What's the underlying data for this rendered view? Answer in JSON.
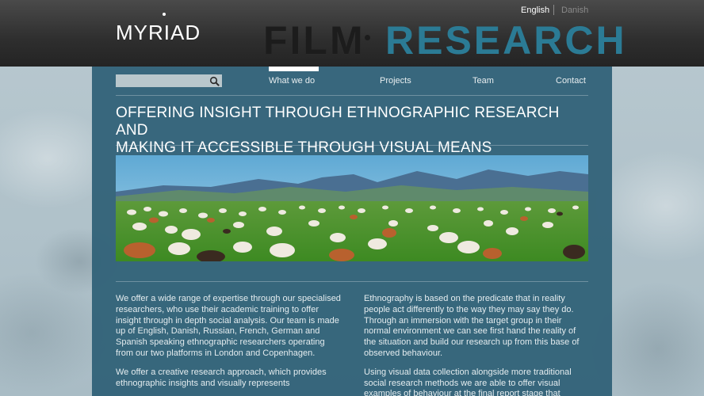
{
  "header": {
    "logo": "MYRIAD",
    "brand_left": "FILM",
    "brand_right": "RESEARCH",
    "languages": [
      {
        "label": "English",
        "active": true
      },
      {
        "label": "Danish",
        "active": false
      }
    ]
  },
  "search": {
    "placeholder": "",
    "value": "",
    "icon": "search-icon"
  },
  "nav": {
    "items": [
      {
        "label": "What we do",
        "active": true
      },
      {
        "label": "Projects",
        "active": false
      },
      {
        "label": "Team",
        "active": false
      },
      {
        "label": "Contact",
        "active": false
      }
    ]
  },
  "main": {
    "headline_line1": "OFFERING INSIGHT THROUGH ETHNOGRAPHIC RESEARCH AND",
    "headline_line2": "MAKING IT ACCESSIBLE THROUGH VISUAL MEANS",
    "col_left": [
      "We offer a wide range of expertise through our specialised researchers, who use their academic training to offer insight through in depth social analysis. Our team is made up of English, Danish, Russian, French, German and Spanish speaking ethnographic researchers operating from our two platforms in London and Copenhagen.",
      "We offer a creative research approach, which provides ethnographic insights and visually represents"
    ],
    "col_right": [
      "Ethnography is based on the predicate that in reality people act differently to the way they may say they do. Through an immersion with the target group in their normal environment we can see first hand the reality of the situation and build our research up from this base of observed behaviour.",
      "Using visual data collection alongside more traditional social research methods we are able to offer visual examples of behaviour at the final report stage that"
    ]
  },
  "colors": {
    "header_bg": "#2e2e2e",
    "brand_accent": "#2b7b95",
    "panel_bg": "#2e6076",
    "page_bg": "#b7c6cd"
  }
}
